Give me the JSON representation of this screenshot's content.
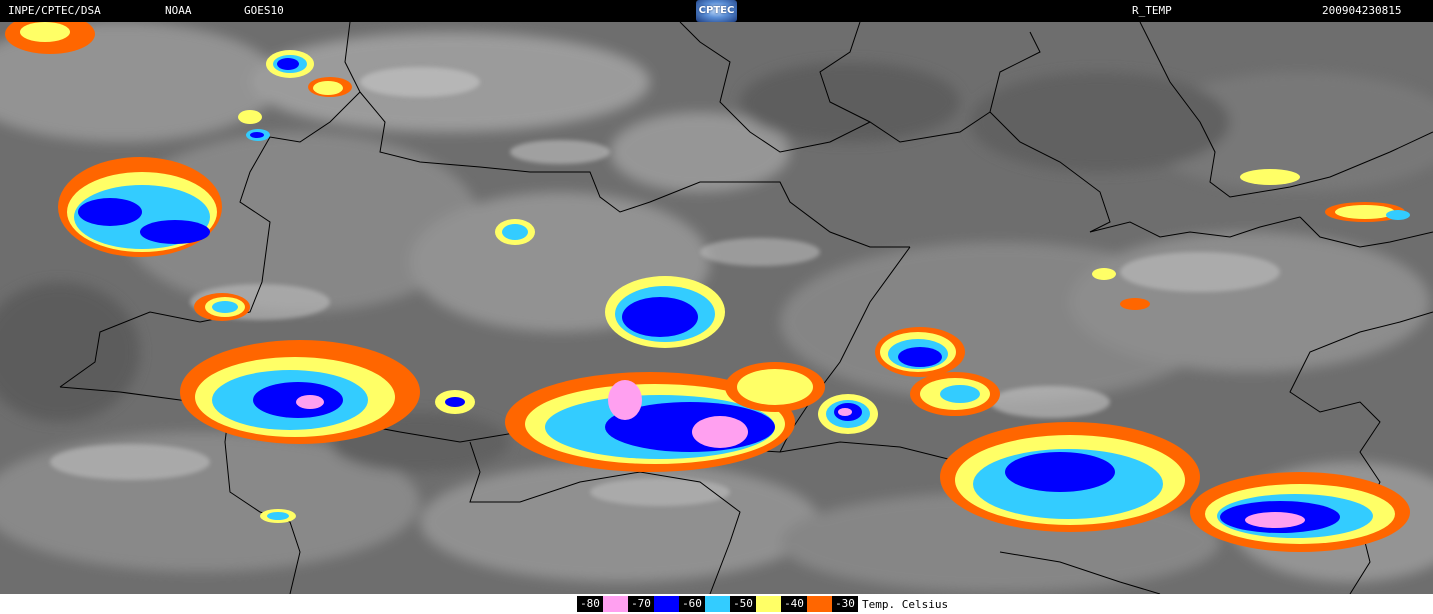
{
  "header": {
    "institution": "INPE/CPTEC/DSA",
    "agency": "NOAA",
    "satellite": "GOES10",
    "logo_text": "CPTEC",
    "product": "R_TEMP",
    "timestamp": "200904230815"
  },
  "legend": {
    "items": [
      {
        "value": "-80",
        "color": "#ffa0f0"
      },
      {
        "value": "-70",
        "color": "#0000ff"
      },
      {
        "value": "-60",
        "color": "#33ccff"
      },
      {
        "value": "-50",
        "color": "#ffff66"
      },
      {
        "value": "-40",
        "color": "#ff6600"
      },
      {
        "value": "-30",
        "color": ""
      }
    ],
    "unit": "Temp. Celsius"
  },
  "colors": {
    "background_gray": "#6e6e6e",
    "cloud_gray": "#b4b4b4",
    "border_line": "#000000"
  }
}
